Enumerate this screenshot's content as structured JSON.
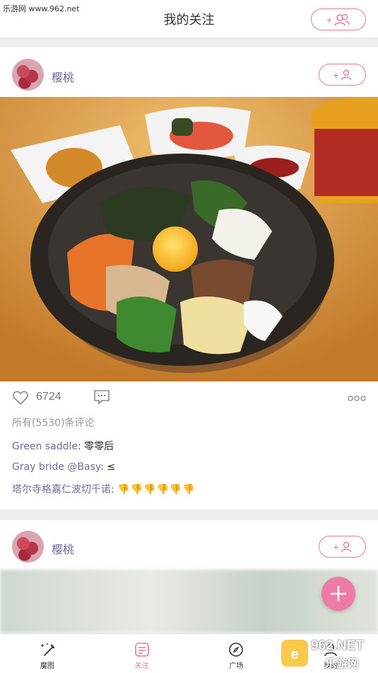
{
  "watermark_top": "乐游网 www.962.net",
  "header": {
    "title": "我的关注"
  },
  "posts": [
    {
      "username": "樱桃",
      "likes": "6724",
      "all_comments": "所有(5530)条评论",
      "comments": [
        {
          "name": "Green saddle",
          "text": "零零后"
        },
        {
          "name": "Gray bride @Basy",
          "text": "≤"
        },
        {
          "name": "塔尔寺格嘉仁波切千诺",
          "text": "👎👎👎👎👎👎"
        }
      ]
    },
    {
      "username": "樱桃"
    }
  ],
  "nav": [
    {
      "label": "魔图",
      "icon": "magic-wand-icon"
    },
    {
      "label": "关注",
      "icon": "follow-icon",
      "active": true
    },
    {
      "label": "广场",
      "icon": "compass-icon"
    },
    {
      "label": "我的",
      "icon": "profile-icon"
    }
  ],
  "watermark_br": {
    "brand": "962.NET",
    "text": "乐游网"
  },
  "colors": {
    "accent": "#e8779f",
    "username": "#6b6e9a"
  }
}
